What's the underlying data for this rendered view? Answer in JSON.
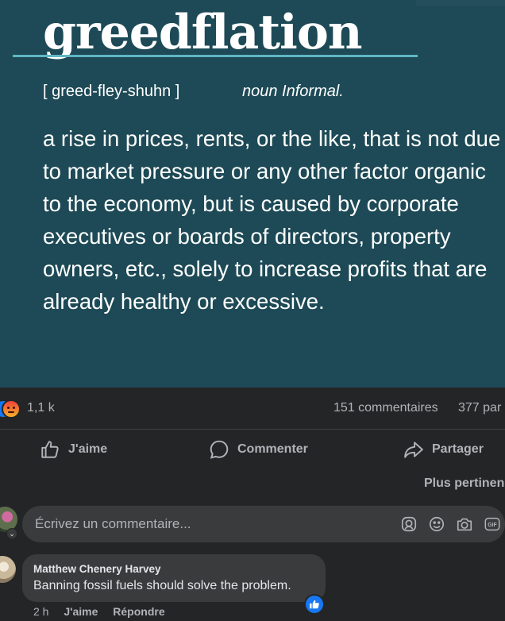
{
  "post": {
    "word": "greedflation",
    "pronunciation": "[ greed-fley-shuhn ]",
    "part_of_speech": "noun Informal.",
    "definition": "a rise in prices, rents, or the like, that is not due to market pressure or any other factor organic to the economy, but is caused by corporate executives or boards of directors, property owners, etc., solely to increase profits that are already healthy or excessive."
  },
  "reactions": {
    "icons": [
      "like-icon",
      "angry-icon"
    ],
    "count": "1,1 k",
    "comments": "151 commentaires",
    "shares": "377 par"
  },
  "actions": {
    "like": "J'aime",
    "comment": "Commenter",
    "share": "Partager"
  },
  "sort": {
    "label": "Plus pertinen"
  },
  "composer": {
    "placeholder": "Écrivez un commentaire...",
    "icons": [
      "avatar-sticker-icon",
      "emoji-icon",
      "camera-icon",
      "gif-icon"
    ]
  },
  "comment": {
    "author": "Matthew Chenery Harvey",
    "text": "Banning fossil fuels should solve the problem.",
    "time": "2 h",
    "like_action": "J'aime",
    "reply_action": "Répondre"
  },
  "colors": {
    "post_background": "#1d4a56",
    "accent_line": "#5fb6c4",
    "page_background": "#242526",
    "bubble": "#3a3b3c",
    "secondary_text": "#b0b3b8",
    "facebook_blue": "#1877f2"
  }
}
